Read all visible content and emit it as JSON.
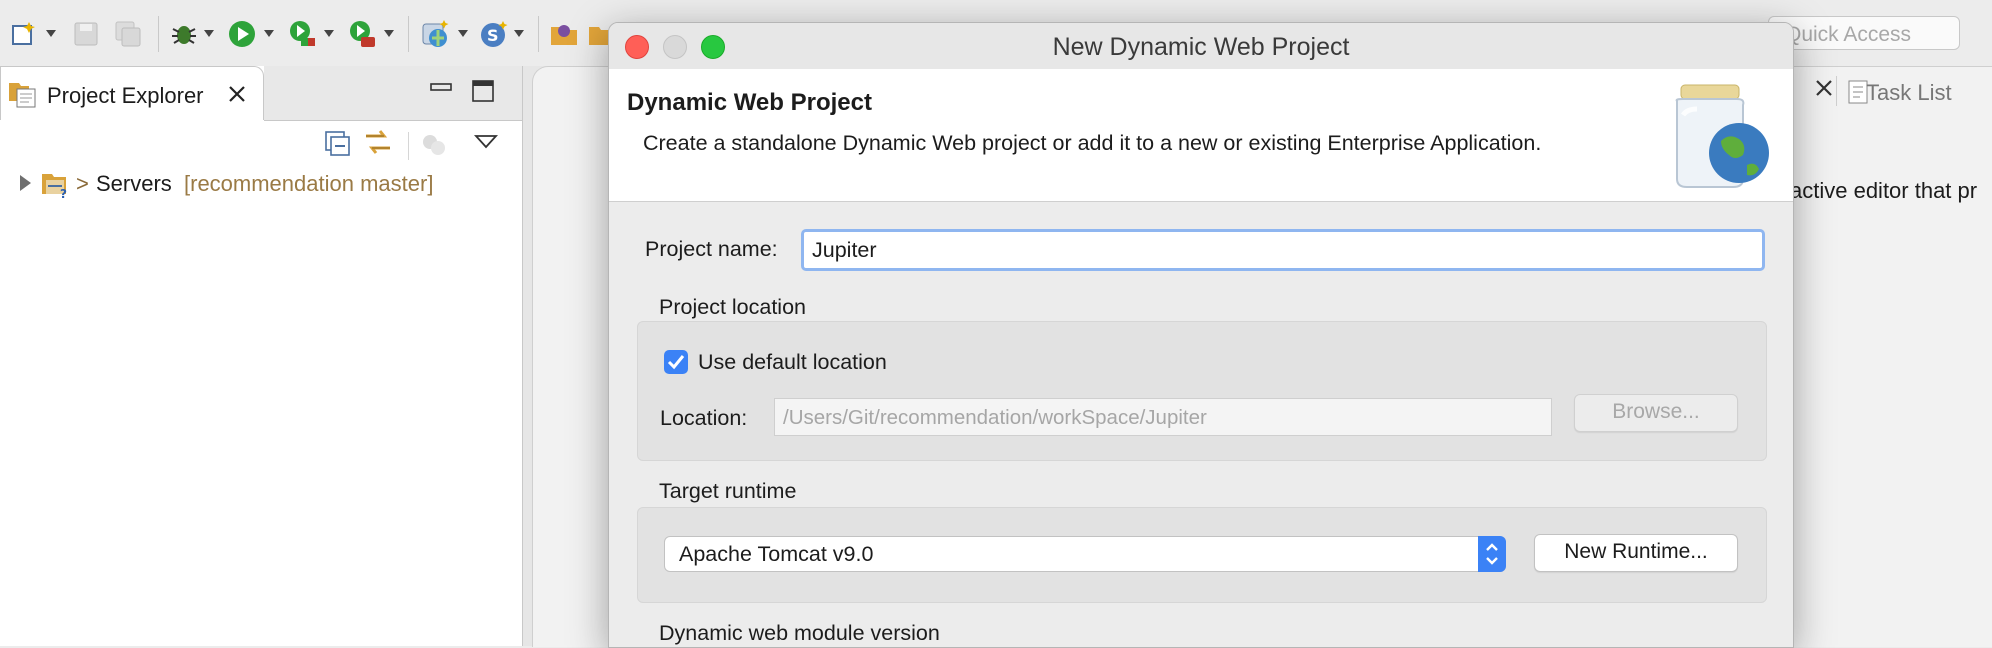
{
  "toolbar": {
    "quick_access_placeholder": "Quick Access",
    "icons": [
      "new-wizard-icon",
      "save-icon",
      "save-all-icon",
      "debug-icon",
      "run-icon",
      "coverage-icon",
      "external-tools-icon",
      "new-server-icon",
      "new-project-icon",
      "open-type-icon",
      "open-folder-icon"
    ]
  },
  "explorer": {
    "tab_label": "Project Explorer",
    "tree": [
      {
        "prefix": ">",
        "name": "Servers",
        "decoration": "[recommendation master]"
      }
    ]
  },
  "editor": {
    "tasklist_label": "Task List",
    "partial_text": "active editor that pr"
  },
  "dialog": {
    "title": "New Dynamic Web Project",
    "banner_title": "Dynamic Web Project",
    "banner_desc": "Create a standalone Dynamic Web project or add it to a new or existing Enterprise Application.",
    "project_name_label": "Project name:",
    "project_name_value": "Jupiter",
    "project_location_heading": "Project location",
    "use_default_label": "Use default location",
    "use_default_checked": true,
    "location_label": "Location:",
    "location_value": "/Users/Git/recommendation/workSpace/Jupiter",
    "browse_label": "Browse...",
    "target_runtime_heading": "Target runtime",
    "runtime_selected": "Apache Tomcat v9.0",
    "new_runtime_label": "New Runtime...",
    "web_module_heading": "Dynamic web module version"
  },
  "colors": {
    "accent": "#3b82f6",
    "close": "#ff5f57",
    "zoom": "#28c840",
    "decoration": "#9a7a45"
  }
}
